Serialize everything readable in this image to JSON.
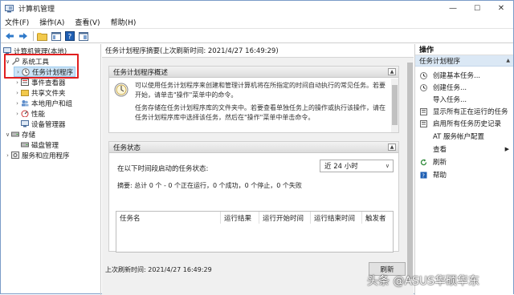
{
  "window": {
    "title": "计算机管理",
    "minimize": "—",
    "maximize": "☐",
    "close": "✕"
  },
  "menu": [
    "文件(F)",
    "操作(A)",
    "查看(V)",
    "帮助(H)"
  ],
  "tree": {
    "root": "计算机管理(本地)",
    "system_tools": "系统工具",
    "task_scheduler": "任务计划程序",
    "event_viewer": "事件查看器",
    "shared_folders": "共享文件夹",
    "local_users": "本地用户和组",
    "performance": "性能",
    "device_manager": "设备管理器",
    "storage": "存储",
    "disk_management": "磁盘管理",
    "services": "服务和应用程序"
  },
  "middle": {
    "header": "任务计划程序摘要(上次刷新时间: 2021/4/27 16:49:29)",
    "overview_title": "任务计划程序概述",
    "overview_lines": [
      "可以使用任务计划程序来创建和管理计算机将在所指定的时间自动执行的常见任务。若要",
      "开始，请单击\"操作\"菜单中的命令。"
    ],
    "overview_lines2": [
      "任务存储在任务计划程序库的文件夹中。若要查看单独任务上的操作或执行该操作，请在",
      "任务计划程序库中选择该任务，然后在\"操作\"菜单中单击命令。"
    ],
    "status_title": "任务状态",
    "status_label": "在以下时间段启动的任务状态:",
    "range_value": "近 24 小时",
    "summary": "摘要: 总计 0 个 - 0 个正在运行，0 个成功，0 个停止，0 个失败",
    "columns": [
      "任务名",
      "运行结果",
      "运行开始时间",
      "运行结束时间",
      "触发者"
    ],
    "last_refresh": "上次刷新时间: 2021/4/27 16:49:29",
    "refresh_button": "刷新"
  },
  "actions": {
    "title": "操作",
    "section": "任务计划程序",
    "items": [
      "创建基本任务...",
      "创建任务...",
      "导入任务...",
      "显示所有正在运行的任务",
      "启用所有任务历史记录",
      "AT 服务帐户配置",
      "查看",
      "刷新",
      "帮助"
    ]
  },
  "watermark": "头条 @ASUS华硕华东",
  "colors": {
    "accent": "#cce4f7",
    "highlight_box": "#e12020",
    "action_section": "#dbe8f5"
  }
}
